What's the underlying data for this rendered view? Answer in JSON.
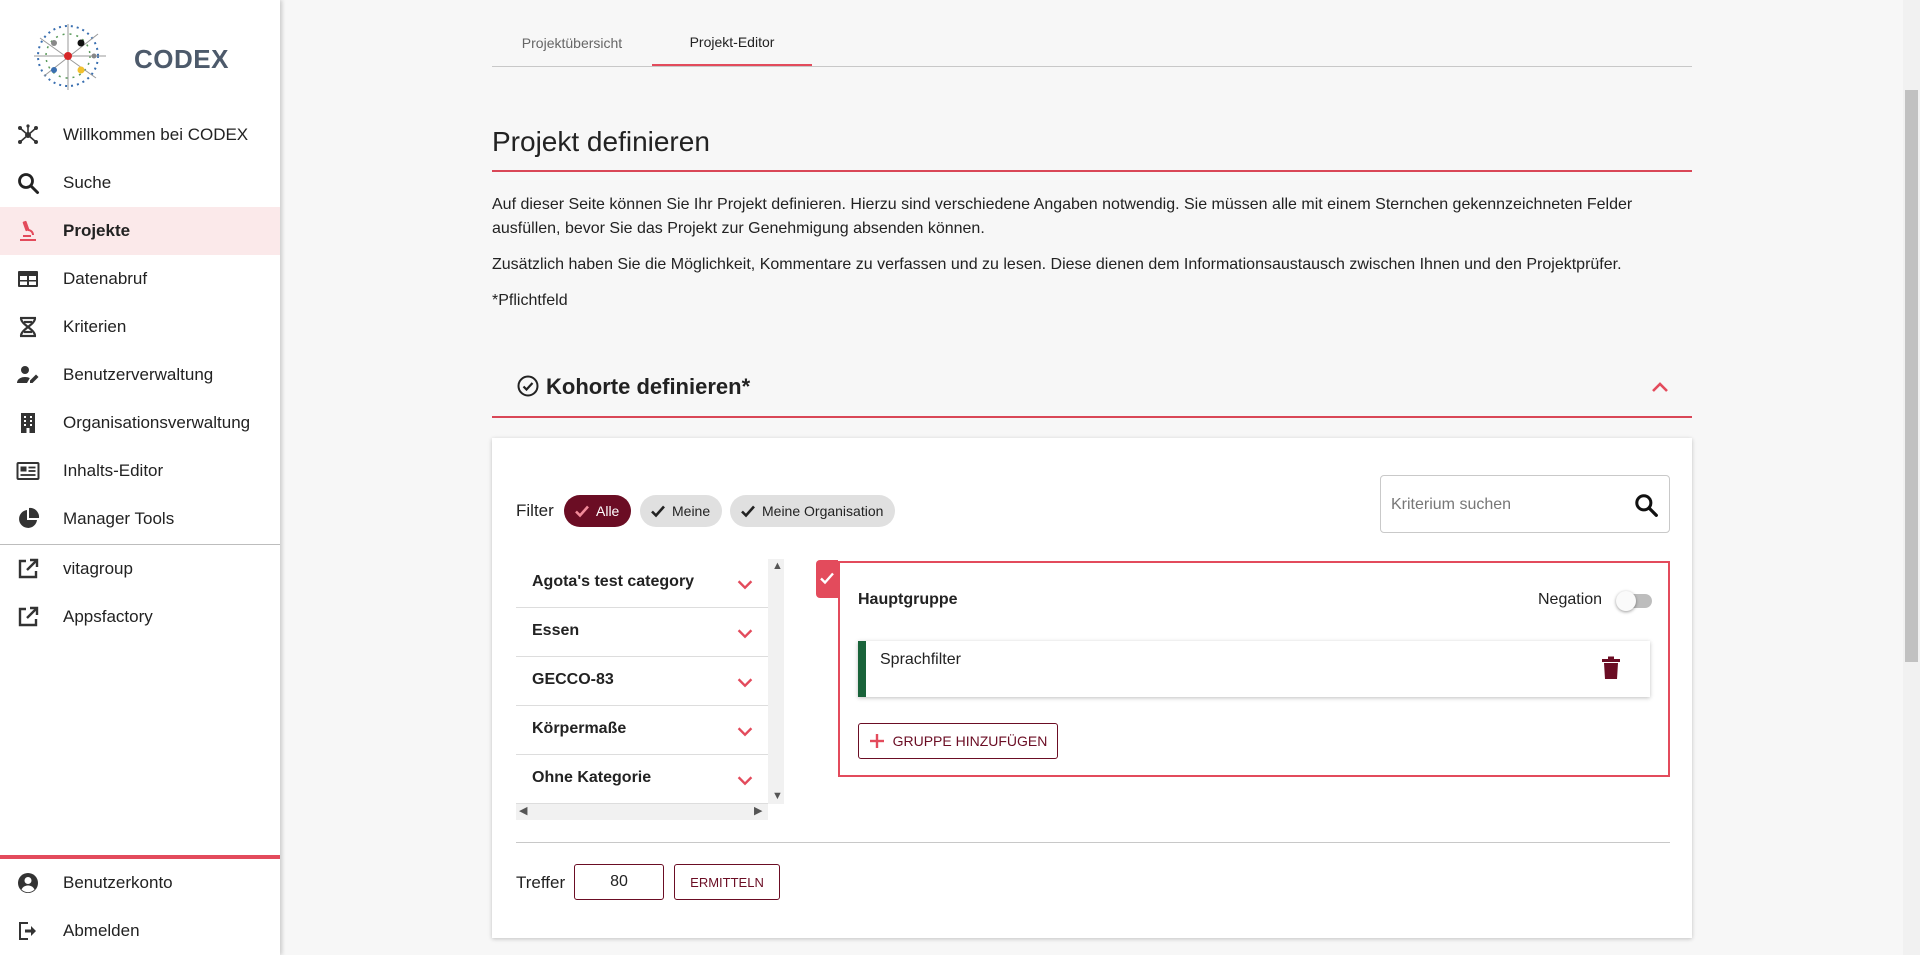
{
  "app": {
    "logo_text": "CODEX"
  },
  "sidebar": {
    "items": [
      {
        "label": "Willkommen bei CODEX",
        "icon": "network-icon"
      },
      {
        "label": "Suche",
        "icon": "search-icon"
      },
      {
        "label": "Projekte",
        "icon": "microscope-icon",
        "active": true
      },
      {
        "label": "Datenabruf",
        "icon": "table-icon"
      },
      {
        "label": "Kriterien",
        "icon": "dna-icon"
      },
      {
        "label": "Benutzerverwaltung",
        "icon": "user-edit-icon"
      },
      {
        "label": "Organisationsverwaltung",
        "icon": "building-icon"
      },
      {
        "label": "Inhalts-Editor",
        "icon": "newspaper-icon"
      },
      {
        "label": "Manager Tools",
        "icon": "pie-chart-icon"
      }
    ],
    "links": [
      {
        "label": "vitagroup",
        "icon": "external-link-icon"
      },
      {
        "label": "Appsfactory",
        "icon": "external-link-icon"
      }
    ],
    "bottom": [
      {
        "label": "Benutzerkonto",
        "icon": "account-circle-icon"
      },
      {
        "label": "Abmelden",
        "icon": "logout-icon"
      }
    ]
  },
  "tabs": [
    {
      "label": "Projektübersicht",
      "active": false
    },
    {
      "label": "Projekt-Editor",
      "active": true
    }
  ],
  "main": {
    "title": "Projekt definieren",
    "paragraph1": "Auf dieser Seite können Sie Ihr Projekt definieren. Hierzu sind verschiedene Angaben notwendig. Sie müssen alle mit einem Sternchen gekennzeichneten Felder ausfüllen, bevor Sie das Projekt zur Genehmigung absenden können.",
    "paragraph2": "Zusätzlich haben Sie die Möglichkeit, Kommentare zu verfassen und zu lesen. Diese dienen dem Informationsaustausch zwischen Ihnen und den Projektprüfer.",
    "required_note": "*Pflichtfeld"
  },
  "cohort": {
    "title": "Kohorte definieren*",
    "filter_label": "Filter",
    "chips": [
      {
        "label": "Alle",
        "selected": true
      },
      {
        "label": "Meine",
        "selected": false
      },
      {
        "label": "Meine Organisation",
        "selected": false
      }
    ],
    "search": {
      "placeholder": "Kriterium suchen",
      "value": ""
    },
    "categories": [
      "Agota's test category",
      "Essen",
      "GECCO-83",
      "Körpermaße",
      "Ohne Kategorie"
    ],
    "group": {
      "title": "Hauptgruppe",
      "negation_label": "Negation",
      "negation_on": false,
      "criterion": "Sprachfilter",
      "add_group_label": "GRUPPE HINZUFÜGEN"
    },
    "treffer_label": "Treffer",
    "treffer_value": "80",
    "ermitteln_label": "ERMITTELN"
  },
  "colors": {
    "accent": "#e34b5c",
    "primary_dark": "#6b0d24",
    "criterion_bar": "#19633a",
    "active_nav_bg": "#fbe9ea"
  }
}
